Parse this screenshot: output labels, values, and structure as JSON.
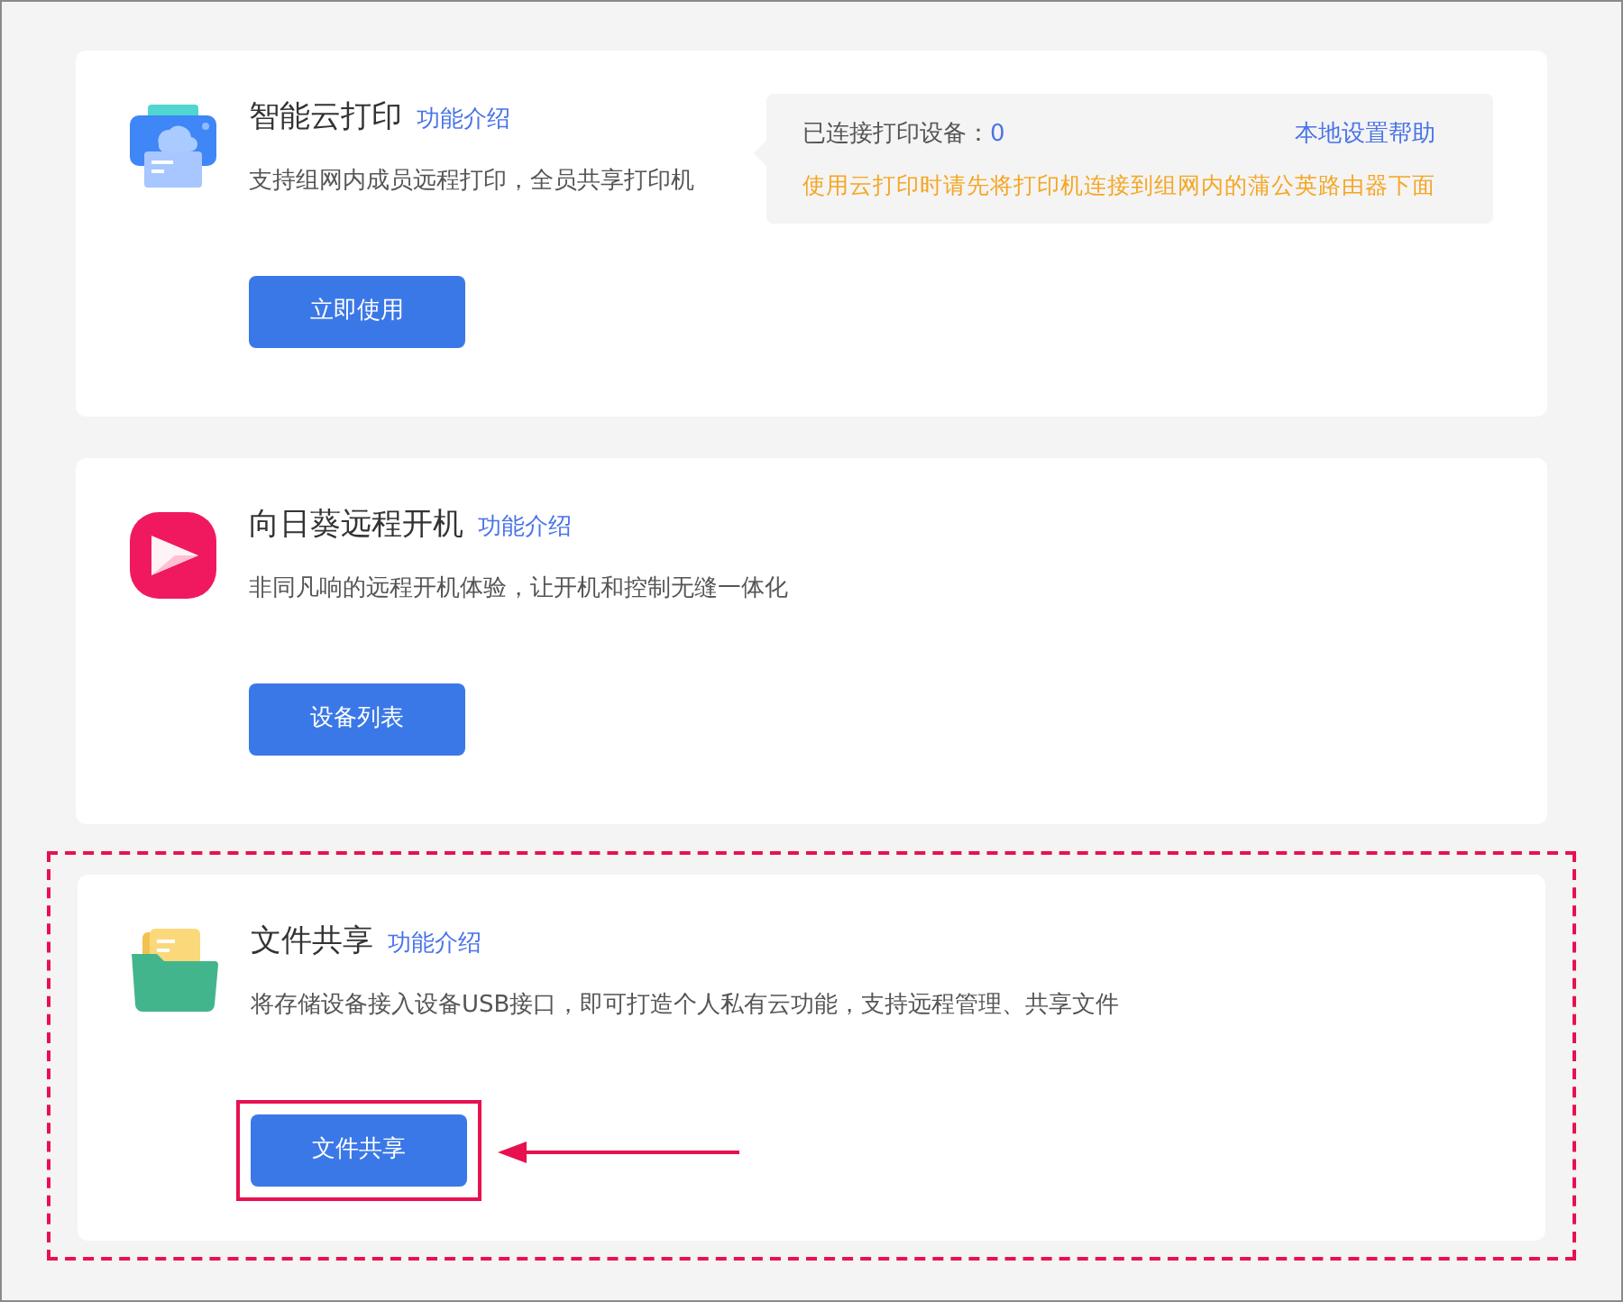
{
  "cards": [
    {
      "kind": "printer",
      "title": "智能云打印",
      "intro_link": "功能介绍",
      "description": "支持组网内成员远程打印，全员共享打印机",
      "info_panel": {
        "label": "已连接打印设备：",
        "count": "0",
        "help_link": "本地设置帮助",
        "notice": "使用云打印时请先将打印机连接到组网内的蒲公英路由器下面"
      },
      "button": "立即使用",
      "highlighted": false
    },
    {
      "kind": "power",
      "title": "向日葵远程开机",
      "intro_link": "功能介绍",
      "description": "非同凡响的远程开机体验，让开机和控制无缝一体化",
      "button": "设备列表",
      "highlighted": false
    },
    {
      "kind": "folder",
      "title": "文件共享",
      "intro_link": "功能介绍",
      "description": "将存储设备接入设备USB接口，即可打造个人私有云功能，支持远程管理、共享文件",
      "button": "文件共享",
      "highlighted": true
    }
  ]
}
